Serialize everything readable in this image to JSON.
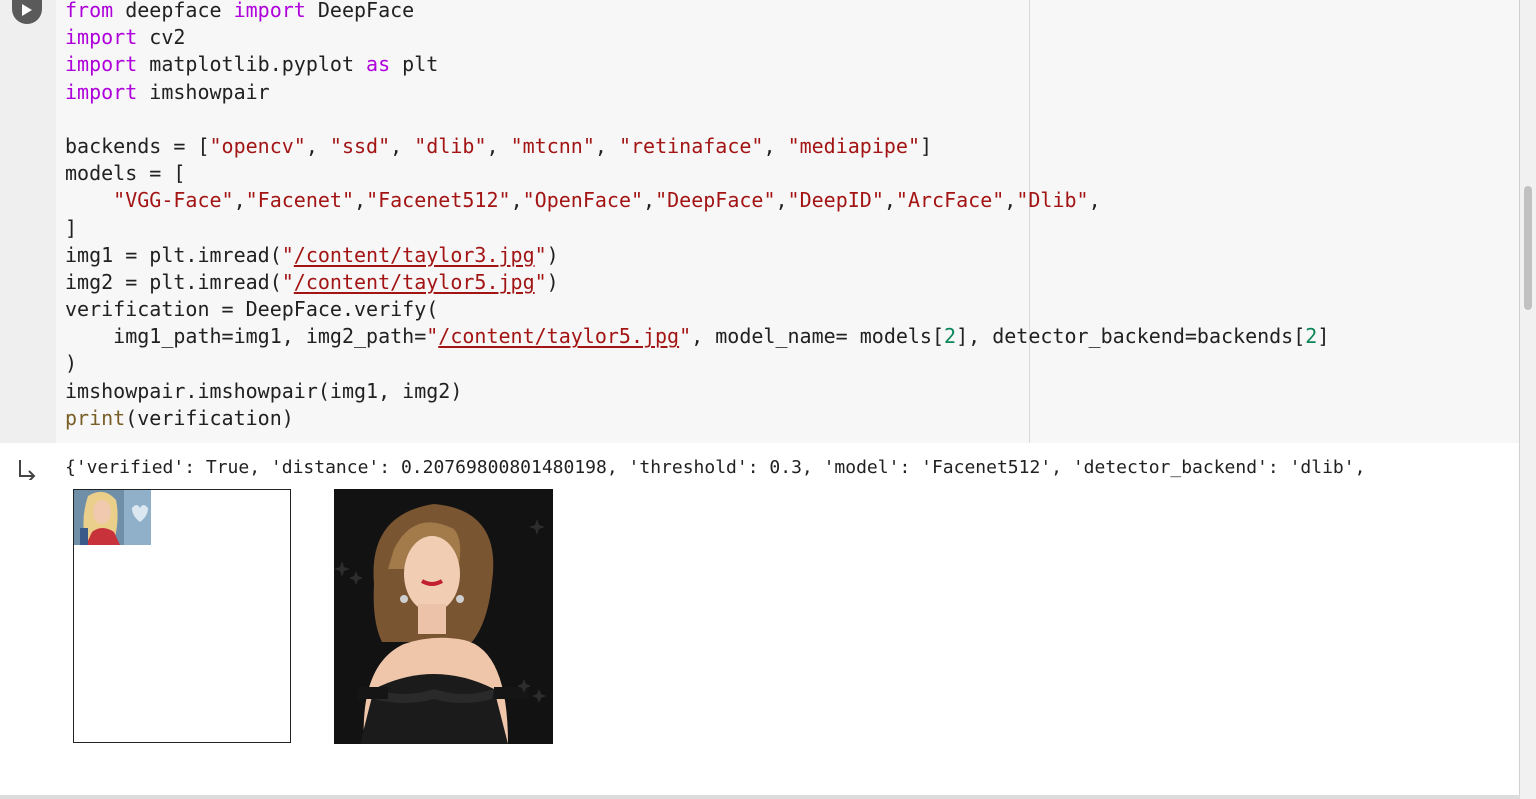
{
  "cell": {
    "run_button": "run-cell",
    "code_lines": [
      [
        {
          "t": "from",
          "c": "kw"
        },
        {
          "t": " deepface "
        },
        {
          "t": "import",
          "c": "kw"
        },
        {
          "t": " DeepFace"
        }
      ],
      [
        {
          "t": "import",
          "c": "kw"
        },
        {
          "t": " cv2"
        }
      ],
      [
        {
          "t": "import",
          "c": "kw"
        },
        {
          "t": " matplotlib.pyplot "
        },
        {
          "t": "as",
          "c": "kw"
        },
        {
          "t": " plt"
        }
      ],
      [
        {
          "t": "import",
          "c": "kw"
        },
        {
          "t": " imshowpair"
        }
      ],
      [],
      [
        {
          "t": "backends = ["
        },
        {
          "t": "\"opencv\"",
          "c": "str"
        },
        {
          "t": ", "
        },
        {
          "t": "\"ssd\"",
          "c": "str"
        },
        {
          "t": ", "
        },
        {
          "t": "\"dlib\"",
          "c": "str"
        },
        {
          "t": ", "
        },
        {
          "t": "\"mtcnn\"",
          "c": "str"
        },
        {
          "t": ", "
        },
        {
          "t": "\"retinaface\"",
          "c": "str"
        },
        {
          "t": ", "
        },
        {
          "t": "\"mediapipe\"",
          "c": "str"
        },
        {
          "t": "]"
        }
      ],
      [
        {
          "t": "models = ["
        }
      ],
      [
        {
          "t": "    "
        },
        {
          "t": "\"VGG-Face\"",
          "c": "str"
        },
        {
          "t": ","
        },
        {
          "t": "\"Facenet\"",
          "c": "str"
        },
        {
          "t": ","
        },
        {
          "t": "\"Facenet512\"",
          "c": "str"
        },
        {
          "t": ","
        },
        {
          "t": "\"OpenFace\"",
          "c": "str"
        },
        {
          "t": ","
        },
        {
          "t": "\"DeepFace\"",
          "c": "str"
        },
        {
          "t": ","
        },
        {
          "t": "\"DeepID\"",
          "c": "str"
        },
        {
          "t": ","
        },
        {
          "t": "\"ArcFace\"",
          "c": "str"
        },
        {
          "t": ","
        },
        {
          "t": "\"Dlib\"",
          "c": "str"
        },
        {
          "t": ","
        }
      ],
      [
        {
          "t": "]"
        }
      ],
      [
        {
          "t": "img1 = plt.imread("
        },
        {
          "t": "\"",
          "c": "str"
        },
        {
          "t": "/content/taylor3.jpg",
          "c": "str link"
        },
        {
          "t": "\"",
          "c": "str"
        },
        {
          "t": ")"
        }
      ],
      [
        {
          "t": "img2 = plt.imread("
        },
        {
          "t": "\"",
          "c": "str"
        },
        {
          "t": "/content/taylor5.jpg",
          "c": "str link"
        },
        {
          "t": "\"",
          "c": "str"
        },
        {
          "t": ")"
        }
      ],
      [
        {
          "t": "verification = DeepFace.verify("
        }
      ],
      [
        {
          "t": "    img1_path=img1, img2_path="
        },
        {
          "t": "\"",
          "c": "str"
        },
        {
          "t": "/content/taylor5.jpg",
          "c": "str link"
        },
        {
          "t": "\"",
          "c": "str"
        },
        {
          "t": ", model_name= models["
        },
        {
          "t": "2",
          "c": "num"
        },
        {
          "t": "], detector_backend=backends["
        },
        {
          "t": "2",
          "c": "num"
        },
        {
          "t": "]"
        }
      ],
      [
        {
          "t": ")"
        }
      ],
      [
        {
          "t": "imshowpair.imshowpair(img1, img2)"
        }
      ],
      [
        {
          "t": "print",
          "c": "fn"
        },
        {
          "t": "(verification)"
        }
      ]
    ]
  },
  "output": {
    "text": "{'verified': True, 'distance': 0.20769800801480198, 'threshold': 0.3, 'model': 'Facenet512', 'detector_backend': 'dlib',",
    "icon": "output-redirect-icon",
    "figures": [
      {
        "name": "img1",
        "content": "small-portrait-thumbnail"
      },
      {
        "name": "img2",
        "content": "portrait-photo"
      }
    ]
  },
  "colors": {
    "keyword": "#af00db",
    "string": "#a31515",
    "number": "#098658",
    "function": "#795e26",
    "code_bg": "#f7f7f7",
    "gutter_bg": "#efefef"
  }
}
